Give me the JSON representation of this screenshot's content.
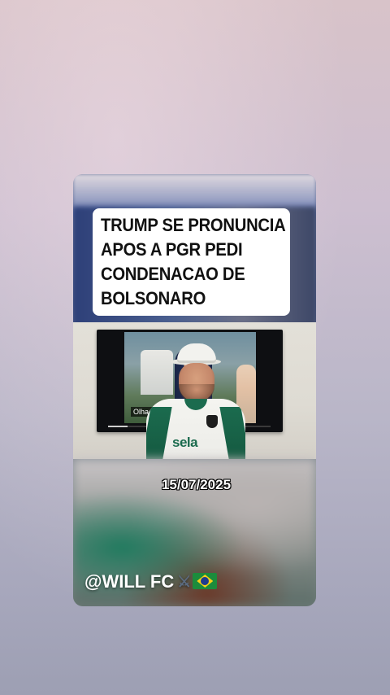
{
  "headline": {
    "lines": [
      "TRUMP SE PRONUNCIA",
      "APOS A PGR PEDI",
      "CONDENACAO DE",
      "BOLSONARO"
    ]
  },
  "video": {
    "tv_subtitle": "Olha, o p...                 ...am",
    "tv_progress": 0.12,
    "shirt_brand": "sela"
  },
  "date_label": "15/07/2025",
  "watermark": {
    "handle": "@WILL FC",
    "swords_icon": "⚔",
    "flag_icon": "brazil-flag"
  },
  "colors": {
    "headline_bg": "#ffffff",
    "text_white": "#ffffff",
    "jersey_green": "#1b6b4e"
  }
}
